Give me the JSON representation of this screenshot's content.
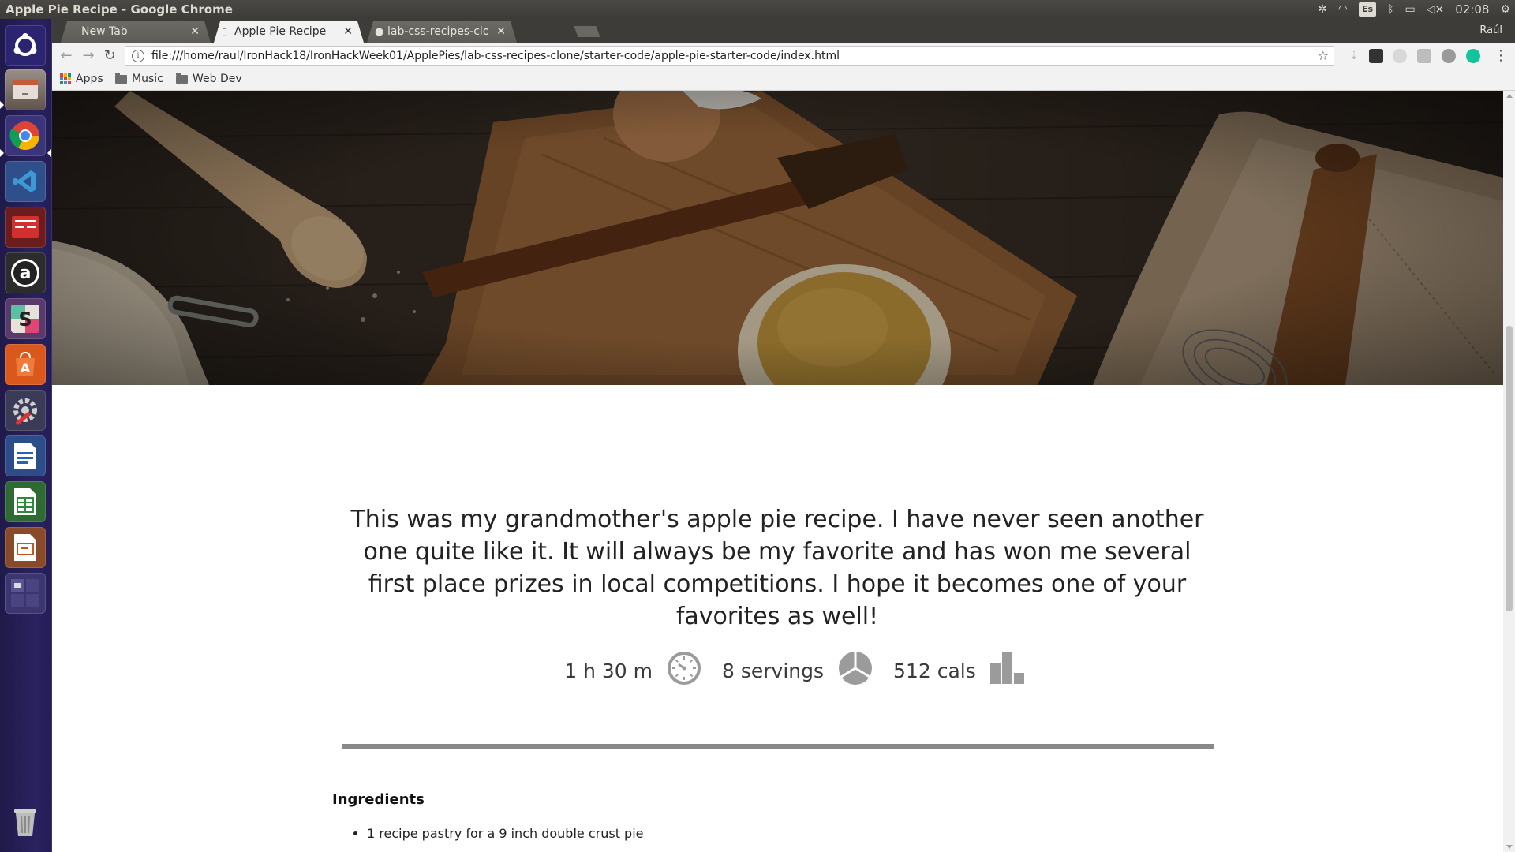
{
  "os": {
    "window_title": "Apple Pie Recipe - Google Chrome",
    "keyboard_layout": "Es",
    "clock": "02:08"
  },
  "browser": {
    "tabs": [
      {
        "label": "New Tab",
        "active": false
      },
      {
        "label": "Apple Pie Recipe",
        "active": true
      },
      {
        "label": "lab-css-recipes-clone",
        "active": false
      }
    ],
    "profile_name": "Raúl",
    "url": "file:///home/raul/IronHack18/IronHackWeek01/ApplePies/lab-css-recipes-clone/starter-code/apple-pie-starter-code/index.html",
    "bookmarks": [
      {
        "label": "Apps",
        "icon": "apps-grid-icon"
      },
      {
        "label": "Music",
        "icon": "folder-icon"
      },
      {
        "label": "Web Dev",
        "icon": "folder-icon"
      }
    ]
  },
  "page": {
    "intro": "This was my grandmother's apple pie recipe. I have never seen another one quite like it. It will always be my favorite and has won me several first place prizes in local competitions. I hope it becomes one of your favorites as well!",
    "stats": {
      "time": "1 h 30 m",
      "servings": "8 servings",
      "calories": "512 cals"
    },
    "ingredients_heading": "Ingredients",
    "ingredients": [
      "1 recipe pastry for a 9 inch double crust pie"
    ]
  },
  "colors": {
    "launcher_bg": "#2a2260",
    "panel_bg": "#3c3b37",
    "stat_icon": "#9b9b9b",
    "divider": "#898989"
  }
}
